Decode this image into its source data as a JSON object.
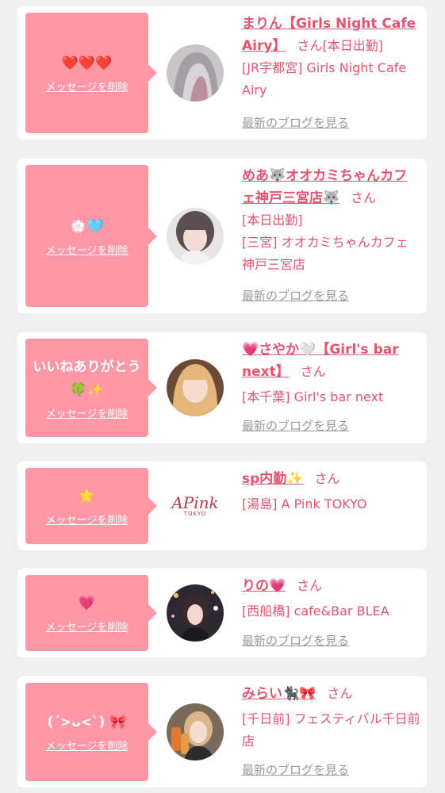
{
  "colors": {
    "accent": "#e5536f",
    "bubble": "#ff97a6",
    "background": "#efefef",
    "link_grey": "#999999"
  },
  "delete_label": "メッセージを削除",
  "san_label": "さん",
  "blog_label": "最新のブログを見る",
  "items": [
    {
      "message": "❤️❤️❤️",
      "name": "まりん【Girls Night Cafe Airy】",
      "status": "[本日出勤]",
      "shop": "[JR宇都宮] Girls Night Cafe Airy",
      "blog_link": "最新のブログを見る",
      "avatar_icon": "gray-hair-avatar"
    },
    {
      "message": "💮🩵",
      "name": "めあ🐺オオカミちゃんカフェ神戸三宮店🐺",
      "status": "[本日出勤]",
      "shop": "[三宮] オオカミちゃんカフェ神戸三宮店",
      "blog_link": "最新のブログを見る",
      "avatar_icon": "girl-portrait-avatar"
    },
    {
      "message": "いいねありがとう\n🍀✨",
      "name": "💗さやか🤍【Girl's bar next】",
      "status": "",
      "shop": "[本千葉] Girl's bar next",
      "blog_link": "最新のブログを見る",
      "avatar_icon": "blonde-girl-avatar"
    },
    {
      "message": "⭐",
      "name": "sp内勤✨",
      "status": "",
      "shop": "[湯島] A Pink TOKYO",
      "blog_link": "",
      "avatar_text": "APink",
      "avatar_sub": "TOKYO",
      "avatar_icon": "apink-logo-avatar"
    },
    {
      "message": "💗",
      "name": "りの💗",
      "status": "",
      "shop": "[西船橋] cafe&Bar BLEA",
      "blog_link": "最新のブログを見る",
      "avatar_icon": "night-city-girl-avatar"
    },
    {
      "message": "(ˊ>ᴗ<ˋ) 🎀",
      "name": "みらい🐈‍⬛🎀",
      "status": "",
      "shop": "[千日前] フェスティバル千日前店",
      "blog_link": "最新のブログを見る",
      "avatar_icon": "girl-with-drinks-avatar"
    }
  ]
}
